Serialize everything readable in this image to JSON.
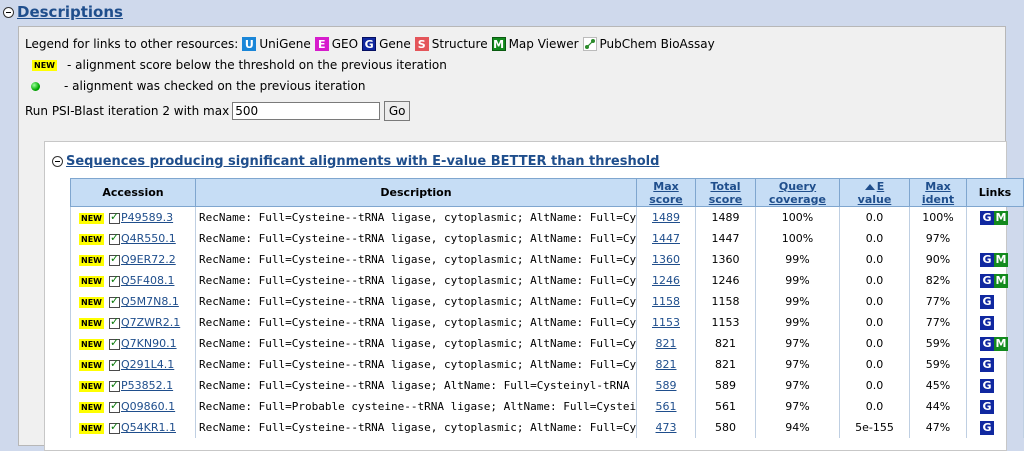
{
  "section": {
    "title": "Descriptions"
  },
  "legend": {
    "label": "Legend for links to other resources:",
    "resources": [
      {
        "icon": "U",
        "name": "UniGene",
        "color": "#1a86d8"
      },
      {
        "icon": "E",
        "name": "GEO",
        "color": "#d61ccc"
      },
      {
        "icon": "G",
        "name": "Gene",
        "color": "#1028a0"
      },
      {
        "icon": "S",
        "name": "Structure",
        "color": "#e4555a"
      },
      {
        "icon": "M",
        "name": "Map Viewer",
        "color": "#138a1e"
      },
      {
        "icon": "pubchem-icon",
        "name": "PubChem BioAssay",
        "color": "#2a8a2a"
      }
    ]
  },
  "notes": {
    "new_badge": "NEW",
    "new_text": "- alignment score below the threshold on the previous iteration",
    "checked_text": "- alignment was checked on the previous iteration"
  },
  "run": {
    "label": "Run PSI-Blast iteration 2 with max",
    "value": "500",
    "go_label": "Go"
  },
  "results": {
    "title": "Sequences producing significant alignments with E-value BETTER than threshold",
    "headers": {
      "accession": "Accession",
      "description": "Description",
      "max_score_1": "Max",
      "max_score_2": "score",
      "total_score_1": "Total",
      "total_score_2": "score",
      "query_coverage_1": "Query",
      "query_coverage_2": "coverage",
      "evalue_1": "E",
      "evalue_2": "value",
      "max_ident_1": "Max",
      "max_ident_2": "ident",
      "links": "Links"
    },
    "rows": [
      {
        "badge": "NEW",
        "accession": "P49589.3",
        "description": "RecName: Full=Cysteine--tRNA ligase, cytoplasmic; AltName: Full=Cy",
        "max_score": "1489",
        "total_score": "1489",
        "coverage": "100%",
        "evalue": "0.0",
        "ident": "100%",
        "links": [
          "G",
          "M"
        ]
      },
      {
        "badge": "NEW",
        "accession": "Q4R550.1",
        "description": "RecName: Full=Cysteine--tRNA ligase, cytoplasmic; AltName: Full=Cy",
        "max_score": "1447",
        "total_score": "1447",
        "coverage": "100%",
        "evalue": "0.0",
        "ident": "97%",
        "links": []
      },
      {
        "badge": "NEW",
        "accession": "Q9ER72.2",
        "description": "RecName: Full=Cysteine--tRNA ligase, cytoplasmic; AltName: Full=Cy",
        "max_score": "1360",
        "total_score": "1360",
        "coverage": "99%",
        "evalue": "0.0",
        "ident": "90%",
        "links": [
          "G",
          "M"
        ]
      },
      {
        "badge": "NEW",
        "accession": "Q5F408.1",
        "description": "RecName: Full=Cysteine--tRNA ligase, cytoplasmic; AltName: Full=Cy",
        "max_score": "1246",
        "total_score": "1246",
        "coverage": "99%",
        "evalue": "0.0",
        "ident": "82%",
        "links": [
          "G",
          "M"
        ]
      },
      {
        "badge": "NEW",
        "accession": "Q5M7N8.1",
        "description": "RecName: Full=Cysteine--tRNA ligase, cytoplasmic; AltName: Full=Cy",
        "max_score": "1158",
        "total_score": "1158",
        "coverage": "99%",
        "evalue": "0.0",
        "ident": "77%",
        "links": [
          "G"
        ]
      },
      {
        "badge": "NEW",
        "accession": "Q7ZWR2.1",
        "description": "RecName: Full=Cysteine--tRNA ligase, cytoplasmic; AltName: Full=Cy",
        "max_score": "1153",
        "total_score": "1153",
        "coverage": "99%",
        "evalue": "0.0",
        "ident": "77%",
        "links": [
          "G"
        ]
      },
      {
        "badge": "NEW",
        "accession": "Q7KN90.1",
        "description": "RecName: Full=Cysteine--tRNA ligase, cytoplasmic; AltName: Full=Cy",
        "max_score": "821",
        "total_score": "821",
        "coverage": "97%",
        "evalue": "0.0",
        "ident": "59%",
        "links": [
          "G",
          "M"
        ]
      },
      {
        "badge": "NEW",
        "accession": "Q291L4.1",
        "description": "RecName: Full=Cysteine--tRNA ligase, cytoplasmic; AltName: Full=Cy",
        "max_score": "821",
        "total_score": "821",
        "coverage": "97%",
        "evalue": "0.0",
        "ident": "59%",
        "links": [
          "G"
        ]
      },
      {
        "badge": "NEW",
        "accession": "P53852.1",
        "description": "RecName: Full=Cysteine--tRNA ligase; AltName: Full=Cysteinyl-tRNA",
        "max_score": "589",
        "total_score": "589",
        "coverage": "97%",
        "evalue": "0.0",
        "ident": "45%",
        "links": [
          "G"
        ]
      },
      {
        "badge": "NEW",
        "accession": "Q09860.1",
        "description": "RecName: Full=Probable cysteine--tRNA ligase; AltName: Full=Cystein",
        "max_score": "561",
        "total_score": "561",
        "coverage": "97%",
        "evalue": "0.0",
        "ident": "44%",
        "links": [
          "G"
        ]
      },
      {
        "badge": "NEW",
        "accession": "Q54KR1.1",
        "description": "RecName: Full=Cysteine--tRNA ligase, cytoplasmic; AltName: Full=Cy",
        "max_score": "473",
        "total_score": "580",
        "coverage": "94%",
        "evalue": "5e-155",
        "ident": "47%",
        "links": [
          "G"
        ]
      }
    ]
  },
  "link_colors": {
    "G": "#1028a0",
    "M": "#138a1e"
  }
}
